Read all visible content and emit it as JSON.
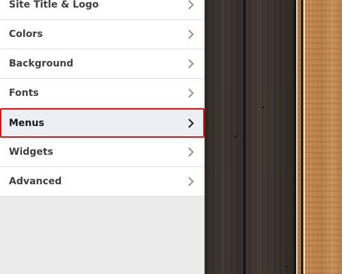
{
  "menu": {
    "items": [
      {
        "label": "Site Title & Logo",
        "active": false
      },
      {
        "label": "Colors",
        "active": false
      },
      {
        "label": "Background",
        "active": false
      },
      {
        "label": "Fonts",
        "active": false
      },
      {
        "label": "Menus",
        "active": true
      },
      {
        "label": "Widgets",
        "active": false
      },
      {
        "label": "Advanced",
        "active": false
      }
    ],
    "chevron_icon": "chevron-right-icon"
  },
  "colors": {
    "panel_background": "#ebebeb",
    "item_background": "#ffffff",
    "active_item_background": "#eeeef5",
    "active_item_border": "#e01010",
    "text": "#3f3f3f"
  }
}
